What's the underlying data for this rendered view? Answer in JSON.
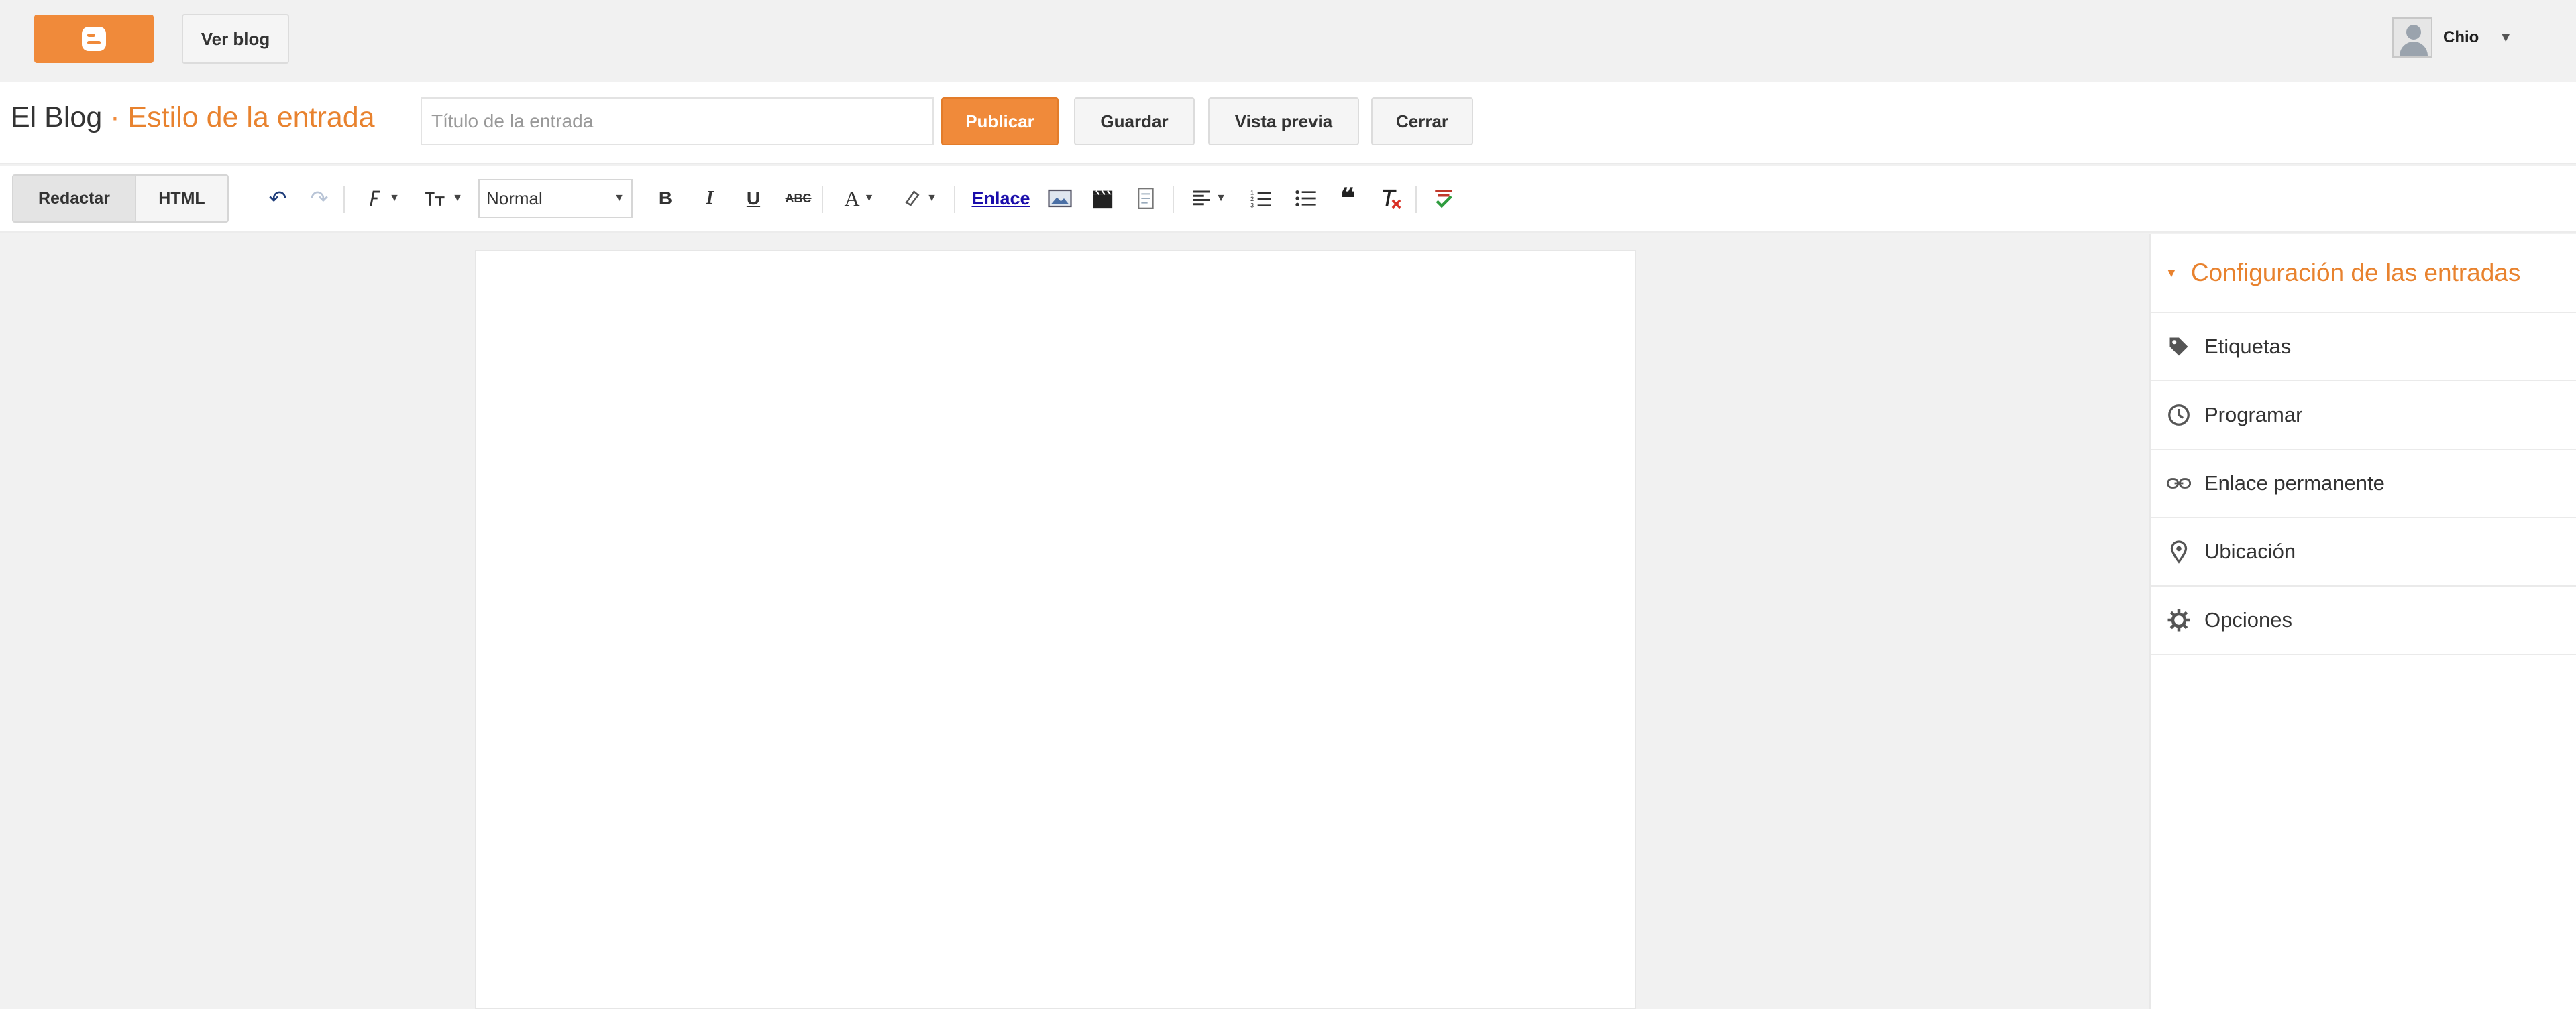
{
  "topbar": {
    "logo_icon": "blogger-logo-icon",
    "view_blog_label": "Ver blog",
    "user_name": "Chio",
    "user_caret": "▼"
  },
  "header": {
    "blog_name": "El Blog",
    "separator": " · ",
    "post_title": "Estilo de la entrada",
    "title_placeholder": "Título de la entrada",
    "title_value": "",
    "publish_label": "Publicar",
    "save_label": "Guardar",
    "preview_label": "Vista previa",
    "close_label": "Cerrar"
  },
  "toolbar": {
    "compose_label": "Redactar",
    "html_label": "HTML",
    "format_value": "Normal",
    "link_label": "Enlace",
    "icons": [
      "undo-icon",
      "redo-icon",
      "font-family-icon",
      "font-size-icon",
      "bold-icon",
      "italic-icon",
      "underline-icon",
      "strikethrough-icon",
      "text-color-icon",
      "highlight-color-icon",
      "link-icon",
      "image-icon",
      "video-icon",
      "page-break-icon",
      "align-icon",
      "numbered-list-icon",
      "bulleted-list-icon",
      "quote-icon",
      "remove-formatting-icon",
      "spellcheck-icon"
    ],
    "bold_glyph": "B",
    "italic_glyph": "I",
    "underline_glyph": "U",
    "strike_glyph": "ABC",
    "text_color_glyph": "A",
    "quote_glyph": "❝",
    "undo_glyph": "↶",
    "redo_glyph": "↷"
  },
  "sidebar": {
    "header": "Configuración de las entradas",
    "items": [
      {
        "label": "Etiquetas",
        "icon": "tag-icon"
      },
      {
        "label": "Programar",
        "icon": "clock-icon"
      },
      {
        "label": "Enlace permanente",
        "icon": "link-chain-icon"
      },
      {
        "label": "Ubicación",
        "icon": "location-pin-icon"
      },
      {
        "label": "Opciones",
        "icon": "gear-icon"
      }
    ]
  },
  "colors": {
    "accent": "#f08a3a",
    "accent_text": "#e8822e",
    "background": "#f1f1f1",
    "link": "#1a0dab"
  }
}
